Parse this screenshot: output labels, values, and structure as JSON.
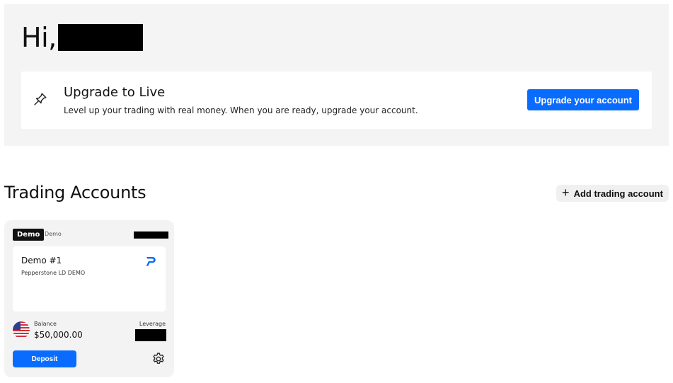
{
  "header": {
    "greeting": "Hi,"
  },
  "upgrade": {
    "icon": "pin-icon",
    "title": "Upgrade to Live",
    "subtitle": "Level up your trading with real money. When you are ready, upgrade your account.",
    "button_label": "Upgrade your account"
  },
  "trading_accounts": {
    "title": "Trading Accounts",
    "add_button_label": "Add trading account",
    "add_icon": "plus-icon",
    "accounts": [
      {
        "badge": "Demo",
        "type_label": "Demo",
        "name": "Demo #1",
        "server": "Pepperstone LD DEMO",
        "brand_icon": "pepperstone-logo-icon",
        "currency_flag": "us-flag-icon",
        "balance_label": "Balance",
        "balance": "$50,000.00",
        "leverage_label": "Leverage",
        "deposit_label": "Deposit",
        "settings_icon": "gear-icon"
      }
    ]
  },
  "colors": {
    "accent": "#0a6cff",
    "hero_bg": "#f4f4f4",
    "card_bg": "#f3f3f3"
  }
}
